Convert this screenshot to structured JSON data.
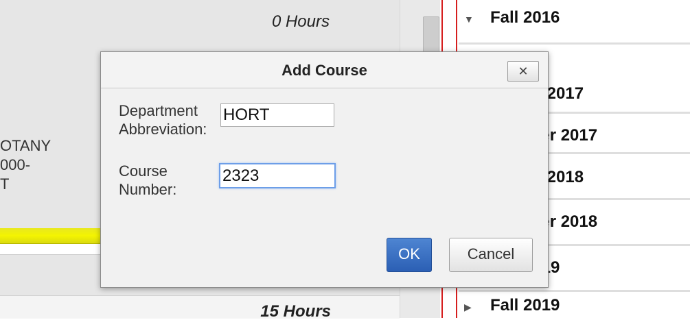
{
  "planner": {
    "top_hours": "0 Hours",
    "course_fragment": "OTANY\n000-\nT",
    "bottom_hours": "15 Hours"
  },
  "semesters": [
    {
      "name": "Fall 2016",
      "expanded": true
    },
    {
      "name": "Spring 2017",
      "expanded": false
    },
    {
      "name": "Summer 2017",
      "expanded": false
    },
    {
      "name": "Spring 2018",
      "expanded": false
    },
    {
      "name": "Summer 2018",
      "expanded": false
    },
    {
      "name": "Fall 2019",
      "expanded": false
    }
  ],
  "icons": {
    "expanded": "triangle-down-icon",
    "collapsed": "triangle-right-icon",
    "close": "close-icon"
  },
  "dialog": {
    "title": "Add Course",
    "close_symbol": "✕",
    "department_label": "Department Abbreviation:",
    "department_value": "HORT",
    "course_number_label": "Course Number:",
    "course_number_value": "2323",
    "ok_label": "OK",
    "cancel_label": "Cancel"
  },
  "colors": {
    "accent_blue": "#2b5fb4",
    "progress_yellow": "#f4f400",
    "divider_red": "#d61e1e"
  }
}
